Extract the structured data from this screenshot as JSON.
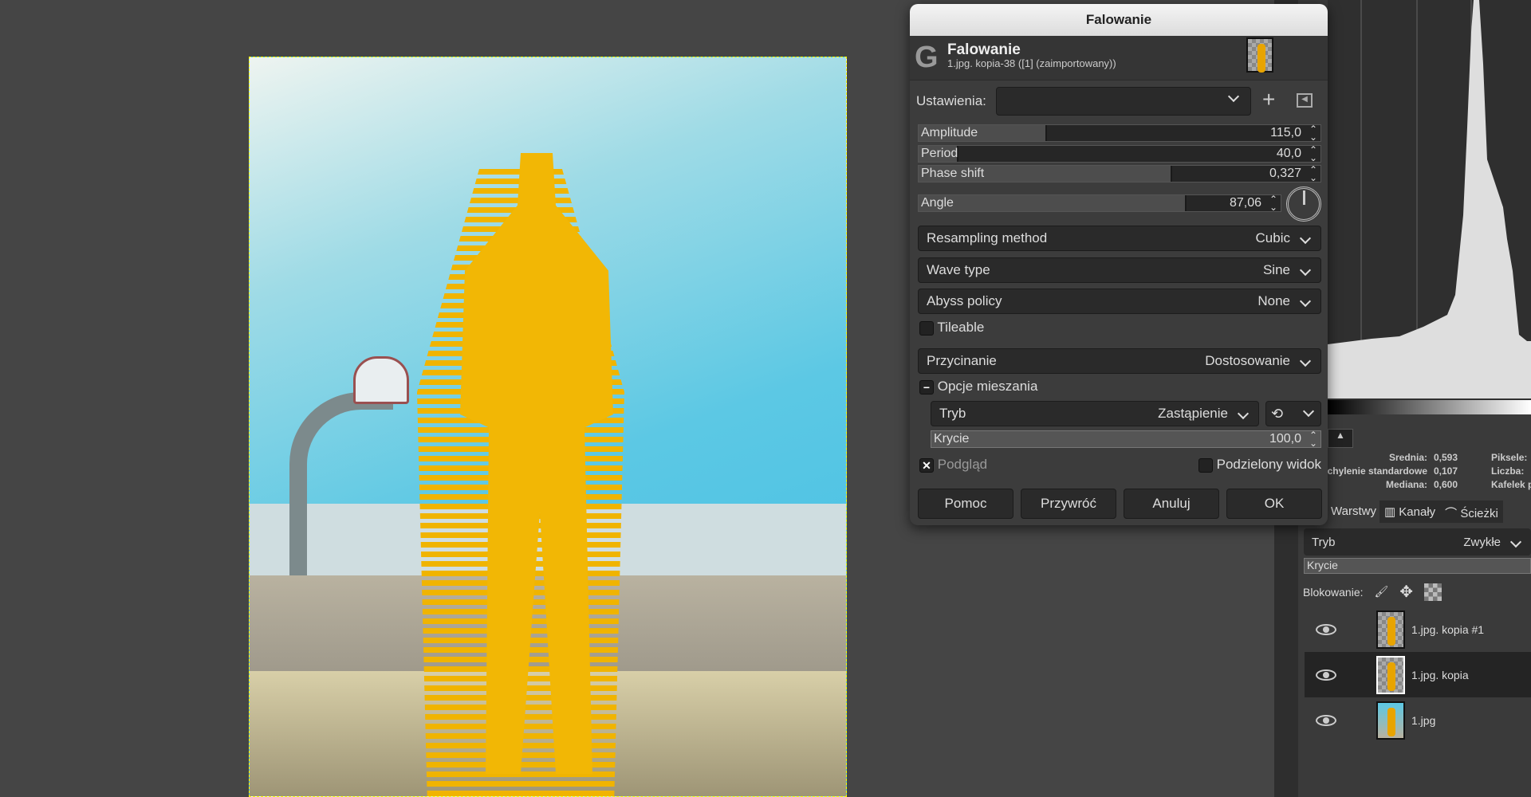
{
  "dialog": {
    "window_title": "Falowanie",
    "header_title": "Falowanie",
    "header_subtitle": "1.jpg. kopia-38 ([1] (zaimportowany))",
    "settings_label": "Ustawienia:",
    "settings_value": "",
    "amplitude": {
      "label": "Amplitude",
      "value": "115,0",
      "fill_percent": 32
    },
    "period": {
      "label": "Period",
      "value": "40,0",
      "fill_percent": 10
    },
    "phase_shift": {
      "label": "Phase shift",
      "value": "0,327",
      "fill_percent": 63
    },
    "angle": {
      "label": "Angle",
      "value": "87,06",
      "fill_percent": 74
    },
    "resampling": {
      "label": "Resampling method",
      "value": "Cubic"
    },
    "wave_type": {
      "label": "Wave type",
      "value": "Sine"
    },
    "abyss": {
      "label": "Abyss policy",
      "value": "None"
    },
    "tileable": {
      "label": "Tileable",
      "checked": false
    },
    "clipping": {
      "label": "Przycinanie",
      "value": "Dostosowanie"
    },
    "blend_section": "Opcje mieszania",
    "mode": {
      "label": "Tryb",
      "value": "Zastąpienie"
    },
    "opacity": {
      "label": "Krycie",
      "value": "100,0"
    },
    "preview": {
      "label": "Podgląd",
      "checked": true
    },
    "split_view": {
      "label": "Podzielony widok",
      "checked": false
    },
    "buttons": {
      "help": "Pomoc",
      "reset": "Przywróć",
      "cancel": "Anuluj",
      "ok": "OK"
    }
  },
  "histogram": {
    "mean_label": "Srednia:",
    "mean": "0,593",
    "std_label": "Odchylenie standardowe:",
    "std": "0,107",
    "median_label": "Mediana:",
    "median": "0,600",
    "pixels_label": "Piksele:",
    "count_label": "Liczba:",
    "cache_label": "Kafelek procent:"
  },
  "dock": {
    "tabs": [
      "Warstwy",
      "Kanały",
      "Ścieżki"
    ],
    "mode_label": "Tryb",
    "mode_value": "Zwykłe",
    "opacity_label": "Krycie",
    "lock_label": "Blokowanie:",
    "layers": [
      {
        "name": "1.jpg. kopia #1",
        "selected": false
      },
      {
        "name": "1.jpg. kopia",
        "selected": true
      },
      {
        "name": "1.jpg",
        "selected": false
      }
    ]
  }
}
